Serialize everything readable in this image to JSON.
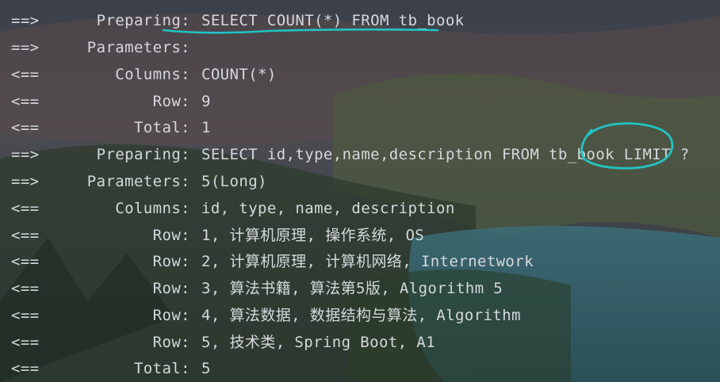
{
  "console": {
    "lines": [
      {
        "arrow": "==>",
        "label": "Preparing:",
        "value": "SELECT COUNT(*) FROM tb_book"
      },
      {
        "arrow": "==>",
        "label": "Parameters:",
        "value": ""
      },
      {
        "arrow": "<==",
        "label": "Columns:",
        "value": "COUNT(*)"
      },
      {
        "arrow": "<==",
        "label": "Row:",
        "value": "9"
      },
      {
        "arrow": "<==",
        "label": "Total:",
        "value": "1"
      },
      {
        "arrow": "==>",
        "label": "Preparing:",
        "value": "SELECT id,type,name,description FROM tb_book LIMIT ?"
      },
      {
        "arrow": "==>",
        "label": "Parameters:",
        "value": "5(Long)"
      },
      {
        "arrow": "<==",
        "label": "Columns:",
        "value": "id, type, name, description"
      },
      {
        "arrow": "<==",
        "label": "Row:",
        "value": "1, 计算机原理, 操作系统, OS"
      },
      {
        "arrow": "<==",
        "label": "Row:",
        "value": "2, 计算机原理, 计算机网络, Internetwork"
      },
      {
        "arrow": "<==",
        "label": "Row:",
        "value": "3, 算法书籍, 算法第5版, Algorithm 5"
      },
      {
        "arrow": "<==",
        "label": "Row:",
        "value": "4, 算法数据, 数据结构与算法, Algorithm"
      },
      {
        "arrow": "<==",
        "label": "Row:",
        "value": "5, 技术类, Spring Boot, A1"
      },
      {
        "arrow": "<==",
        "label": "Total:",
        "value": "5"
      }
    ]
  },
  "annotations": {
    "ink_color": "#21c4c4"
  }
}
